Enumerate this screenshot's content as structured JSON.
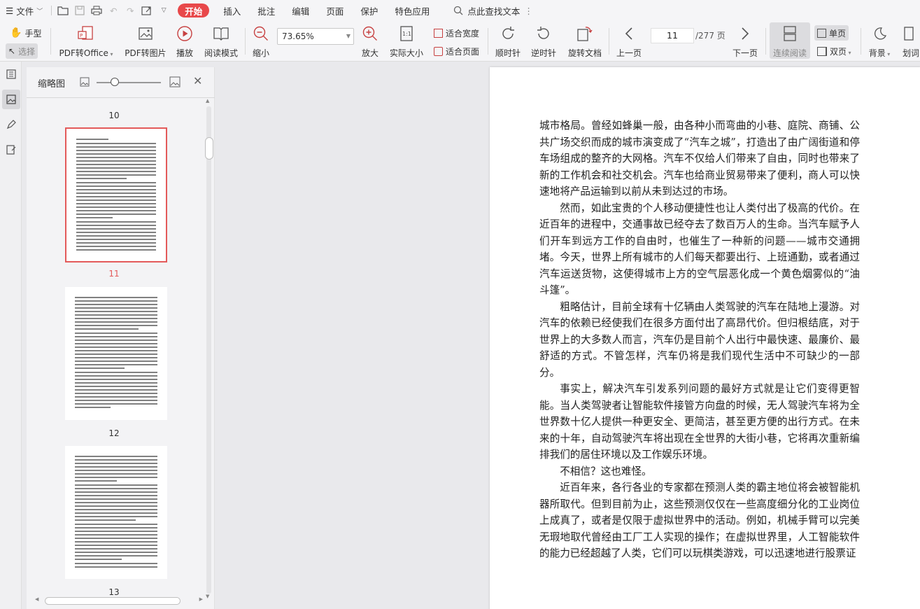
{
  "menubar": {
    "file": "文件",
    "tabs": [
      "开始",
      "插入",
      "批注",
      "编辑",
      "页面",
      "保护",
      "特色应用"
    ],
    "search": "点此查找文本"
  },
  "ribbon": {
    "hand": "手型",
    "select": "选择",
    "pdf_to_office": "PDF转Office",
    "pdf_to_image": "PDF转图片",
    "play": "播放",
    "read_mode": "阅读模式",
    "zoom_out": "缩小",
    "zoom_value": "73.65%",
    "zoom_in": "放大",
    "actual_size": "实际大小",
    "fit_width": "适合宽度",
    "fit_page": "适合页面",
    "clockwise": "顺时针",
    "counter_clockwise": "逆时针",
    "rotate_doc": "旋转文档",
    "prev_page": "上一页",
    "current_page": "11",
    "total_pages": "/277 页",
    "next_page": "下一页",
    "continuous": "连续阅读",
    "single_page": "单页",
    "double_page": "双页",
    "background": "背景",
    "highlight": "划词"
  },
  "thumbnails": {
    "title": "缩略图",
    "page_labels": [
      "10",
      "11",
      "12",
      "13"
    ]
  },
  "document": {
    "paragraphs": [
      {
        "indent": false,
        "text": "城市格局。曾经如蜂巢一般，由各种小而弯曲的小巷、庭院、商铺、公共广场交织而成的城市演变成了“汽车之城”，打造出了由广阔街道和停车场组成的整齐的大网格。汽车不仅给人们带来了自由，同时也带来了新的工作机会和社交机会。汽车也给商业贸易带来了便利，商人可以快速地将产品运输到以前从未到达过的市场。"
      },
      {
        "indent": true,
        "text": "然而，如此宝贵的个人移动便捷性也让人类付出了极高的代价。在近百年的进程中，交通事故已经夺去了数百万人的生命。当汽车赋予人们开车到远方工作的自由时，也催生了一种新的问题——城市交通拥堵。今天，世界上所有城市的人们每天都要出行、上班通勤，或者通过汽车运送货物，这使得城市上方的空气层恶化成一个黄色烟雾似的“油斗篷”。"
      },
      {
        "indent": true,
        "text": "粗略估计，目前全球有十亿辆由人类驾驶的汽车在陆地上漫游。对汽车的依赖已经使我们在很多方面付出了高昂代价。但归根结底，对于世界上的大多数人而言，汽车仍是目前个人出行中最快速、最廉价、最舒适的方式。不管怎样，汽车仍将是我们现代生活中不可缺少的一部分。"
      },
      {
        "indent": true,
        "text": "事实上，解决汽车引发系列问题的最好方式就是让它们变得更智能。当人类驾驶者让智能软件接管方向盘的时候，无人驾驶汽车将为全世界数十亿人提供一种更安全、更简洁，甚至更方便的出行方式。在未来的十年，自动驾驶汽车将出现在全世界的大街小巷，它将再次重新编排我们的居住环境以及工作娱乐环境。"
      },
      {
        "indent": true,
        "text": "不相信？这也难怪。"
      },
      {
        "indent": true,
        "text": "近百年来，各行各业的专家都在预测人类的霸主地位将会被智能机器所取代。但到目前为止，这些预测仅仅在一些高度细分化的工业岗位上成真了，或者是仅限于虚拟世界中的活动。例如，机械手臂可以完美无瑕地取代曾经由工厂工人实现的操作；在虚拟世界里，人工智能软件的能力已经超越了人类，它们可以玩棋类游戏，可以迅速地进行股票证"
      }
    ]
  },
  "colors": {
    "accent": "#e8484a",
    "selected_thumb_border": "#e35a5a"
  }
}
